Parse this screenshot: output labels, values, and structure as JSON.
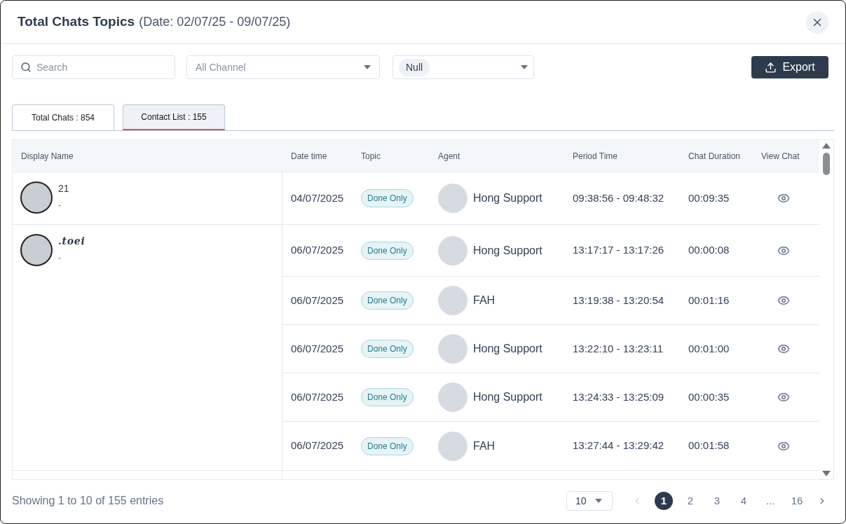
{
  "dialog": {
    "title": "Total Chats Topics",
    "subtitle": "(Date: 02/07/25 - 09/07/25)"
  },
  "filters": {
    "search": {
      "placeholder": "Search"
    },
    "channel": {
      "placeholder": "All Channel"
    },
    "topic": {
      "chip": "Null"
    },
    "export": "Export"
  },
  "tabs": [
    {
      "label": "Total Chats : 854",
      "selected": false
    },
    {
      "label": "Contact List : 155",
      "selected": true
    }
  ],
  "table": {
    "columns": [
      "Display Name",
      "Date time",
      "Topic",
      "Agent",
      "Period Time",
      "Chat Duration",
      "View Chat"
    ],
    "contacts": [
      {
        "name": "21",
        "italic": false,
        "note": "-",
        "chats": [
          {
            "date": "04/07/2025",
            "topic": "Done Only",
            "agent": "Hong Support",
            "period": "09:38:56 - 09:48:32",
            "duration": "00:09:35"
          }
        ]
      },
      {
        "name": ".toei",
        "italic": true,
        "note": "-",
        "chats": [
          {
            "date": "06/07/2025",
            "topic": "Done Only",
            "agent": "Hong Support",
            "period": "13:17:17 - 13:17:26",
            "duration": "00:00:08"
          },
          {
            "date": "06/07/2025",
            "topic": "Done Only",
            "agent": "FAH",
            "period": "13:19:38 - 13:20:54",
            "duration": "00:01:16"
          },
          {
            "date": "06/07/2025",
            "topic": "Done Only",
            "agent": "Hong Support",
            "period": "13:22:10 - 13:23:11",
            "duration": "00:01:00"
          },
          {
            "date": "06/07/2025",
            "topic": "Done Only",
            "agent": "Hong Support",
            "period": "13:24:33 - 13:25:09",
            "duration": "00:00:35"
          },
          {
            "date": "06/07/2025",
            "topic": "Done Only",
            "agent": "FAH",
            "period": "13:27:44 - 13:29:42",
            "duration": "00:01:58"
          }
        ]
      }
    ]
  },
  "footer": {
    "summary": "Showing 1 to 10 of 155 entries",
    "page_size": "10",
    "pages": [
      {
        "label": "1",
        "selected": true
      },
      {
        "label": "2",
        "selected": false
      },
      {
        "label": "3",
        "selected": false
      },
      {
        "label": "4",
        "selected": false
      },
      {
        "label": "...",
        "selected": false
      },
      {
        "label": "16",
        "selected": false
      }
    ]
  }
}
